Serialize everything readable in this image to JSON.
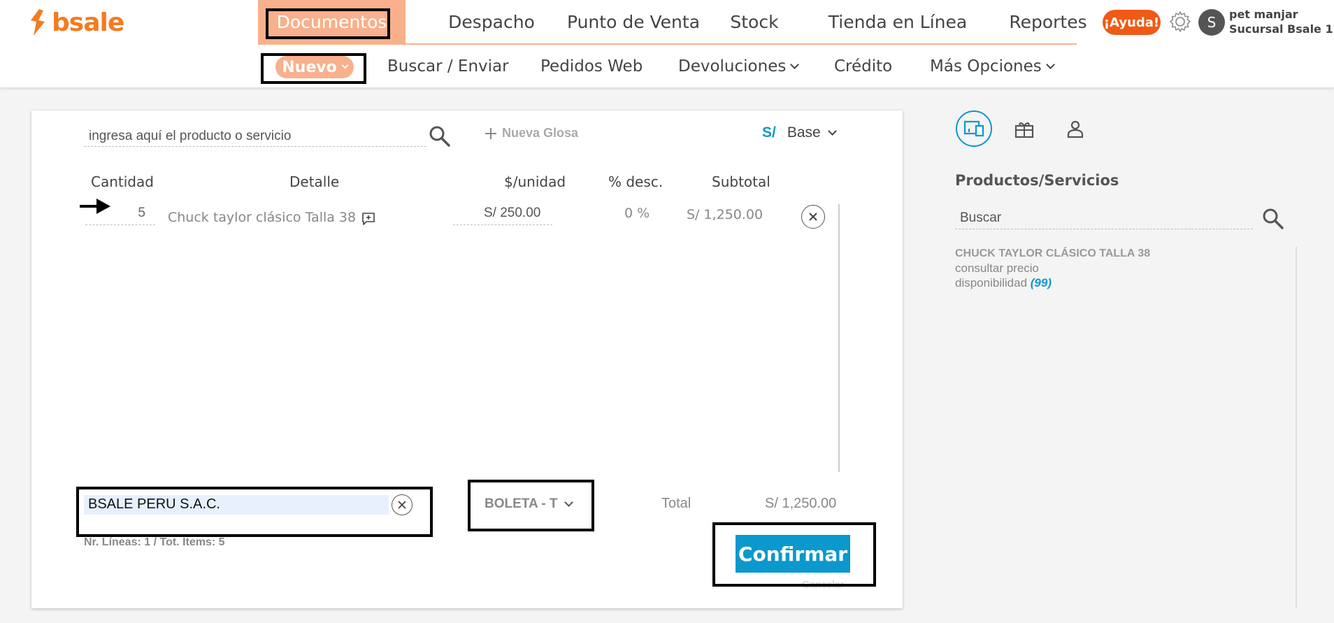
{
  "brand": {
    "name": "bsale",
    "color": "#f47b20"
  },
  "mainnav": {
    "items": [
      {
        "label": "Documentos",
        "active": true
      },
      {
        "label": "Despacho"
      },
      {
        "label": "Punto de Venta"
      },
      {
        "label": "Stock"
      },
      {
        "label": "Tienda en Línea"
      },
      {
        "label": "Reportes"
      }
    ]
  },
  "header": {
    "help_label": "¡Ayuda!",
    "settings_icon": "gear-icon",
    "avatar_initial": "S",
    "user_name": "pet manjar",
    "branch": "Sucursal Bsale 1"
  },
  "subnav": {
    "items": [
      {
        "label": "Nuevo",
        "active": true
      },
      {
        "label": "Buscar / Enviar"
      },
      {
        "label": "Pedidos Web"
      },
      {
        "label": "Devoluciones"
      },
      {
        "label": "Crédito"
      },
      {
        "label": "Más Opciones"
      }
    ]
  },
  "document": {
    "product_search_placeholder": "ingresa aquí el producto o servicio",
    "new_gloss_label": "Nueva Glosa",
    "currency_symbol": "S/",
    "price_list": "Base",
    "columns": [
      "Cantidad",
      "Detalle",
      "$/unidad",
      "% desc.",
      "Subtotal"
    ],
    "rows": [
      {
        "quantity": "5",
        "detail": "Chuck taylor clásico Talla 38",
        "unit_price": "S/ 250.00",
        "discount": "0 %",
        "subtotal": "S/ 1,250.00"
      }
    ],
    "client": "BSALE PERU S.A.C.",
    "doc_type": "BOLETA - T",
    "total_label": "Total",
    "total_value": "S/ 1,250.00",
    "line_summary": "Nr. Líneas: 1 / Tot. Items: 5",
    "confirm_label": "Confirmar",
    "cancel_label": "Cancelar"
  },
  "side_panel": {
    "title": "Productos/Servicios",
    "search_placeholder": "Buscar",
    "result": {
      "name": "CHUCK TAYLOR CLÁSICO TALLA 38",
      "price_note": "consultar precio",
      "availability_label": "disponibilidad",
      "availability_value": "(99)"
    }
  },
  "colors": {
    "accent_orange": "#f9b08c",
    "help_orange": "#f05a14",
    "confirm_blue": "#0b98cc",
    "link_blue": "#0b98cc"
  }
}
